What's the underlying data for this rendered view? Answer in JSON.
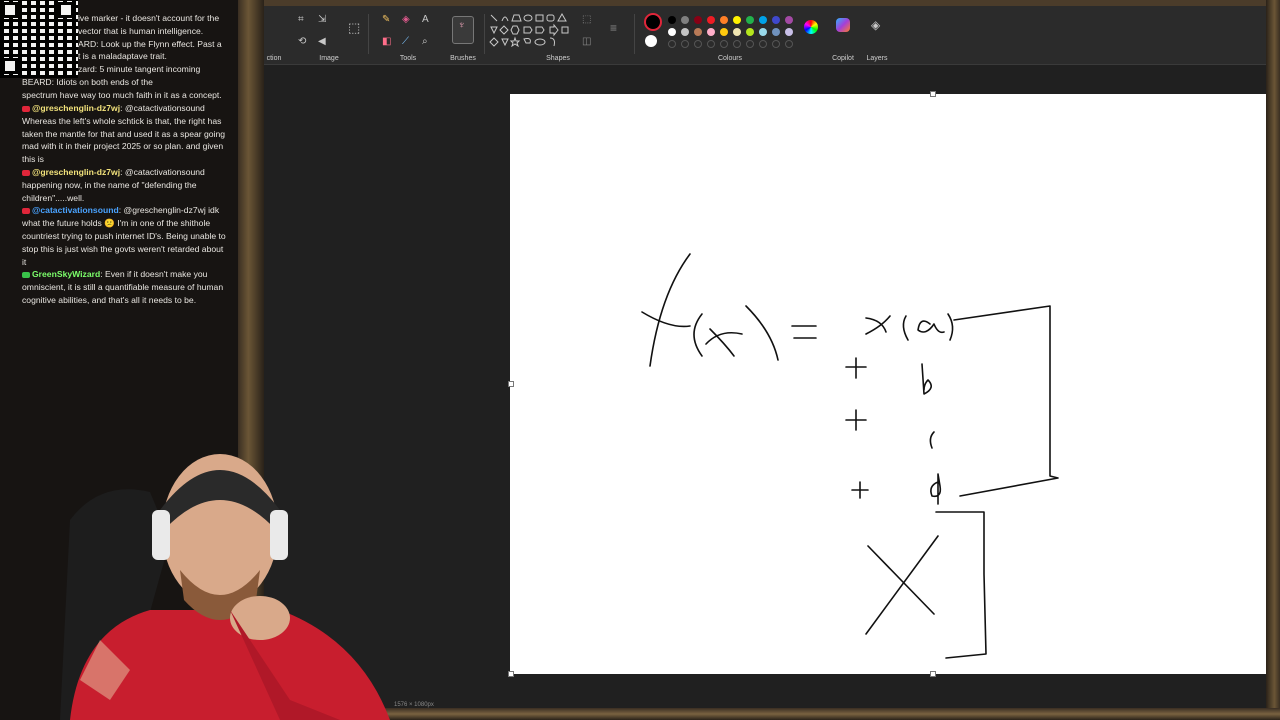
{
  "chat": {
    "top_lines": [
      "ive marker - it doesn't account for the",
      "vector that is human intelligence.",
      "ARD: Look up the Flynn effect. Past a",
      "t is a maladaptave trait.",
      "zard: 5 minute tangent incoming",
      "BEARD: Idiots on both ends of the",
      "spectrum have way too much faith in it as a concept."
    ],
    "messages": [
      {
        "user": "@greschenglin-dz7wj",
        "lines": [
          ": @catactivationsound",
          "Whereas the left's whole schtick is that, the right has",
          "taken the mantle for that and used it as a spear going",
          "mad with it in their project 2025 or so plan. and given",
          "this is"
        ]
      },
      {
        "user": "@greschenglin-dz7wj",
        "lines": [
          ": @catactivationsound",
          "happening now, in the name of \"defending the",
          "children\".....well."
        ]
      },
      {
        "user": "@catactivationsound",
        "lines": [
          ": @greschenglin-dz7wj idk",
          "what the future holds 😕 I'm in one of the shithole",
          "countriest trying to push internet ID's. Being unable to",
          "stop this is just wish the govts weren't retarded about",
          "it"
        ]
      },
      {
        "user": "GreenSkyWizard",
        "lines": [
          ": Even if it doesn't make you",
          "omniscient, it is still a quantifiable measure of human",
          "cognitive abilities, and that's all it needs to be."
        ]
      }
    ]
  },
  "ribbon": {
    "groups": [
      "ction",
      "Image",
      "Tools",
      "Brushes",
      "Shapes",
      "Colours",
      "Copilot",
      "Layers"
    ]
  },
  "colors": {
    "row1": [
      "#000000",
      "#7f7f7f",
      "#880015",
      "#ed1c24",
      "#ff7f27",
      "#fff200",
      "#22b14c",
      "#00a2e8",
      "#3f48cc",
      "#a349a4"
    ],
    "row2": [
      "#ffffff",
      "#c3c3c3",
      "#b97a57",
      "#ffaec9",
      "#ffc90e",
      "#efe4b0",
      "#b5e61d",
      "#99d9ea",
      "#7092be",
      "#c8bfe7"
    ]
  },
  "status": {
    "canvas_size": "1576 × 1080px"
  }
}
